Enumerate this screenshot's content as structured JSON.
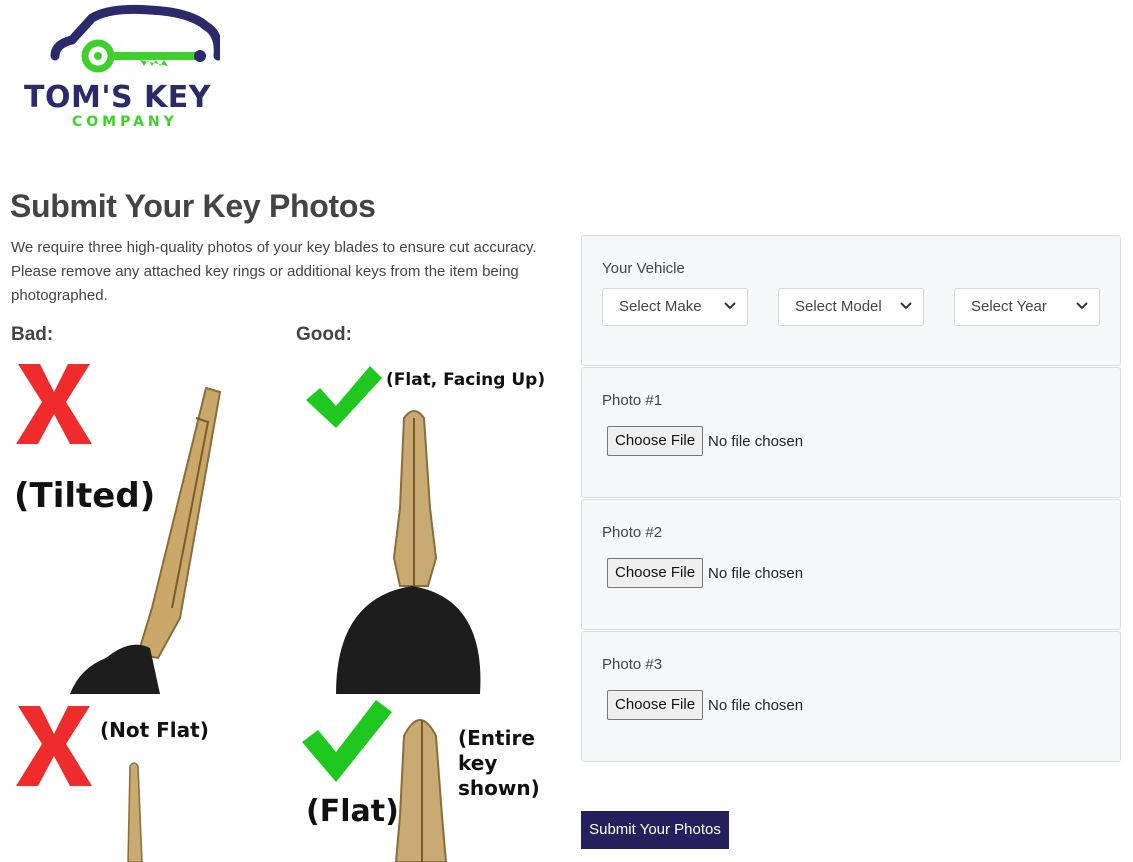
{
  "brand": {
    "name": "TOM'S KEY",
    "tagline": "COMPANY",
    "colors": {
      "navy": "#2b2a6b",
      "green": "#3ed12e"
    }
  },
  "page": {
    "title": "Submit Your Key Photos",
    "intro": "We require three high-quality photos of your key blades to ensure cut accuracy. Please remove any attached key rings or additional keys from the item being photographed."
  },
  "examples": {
    "bad_label": "Bad:",
    "good_label": "Good:",
    "bad_tilted_caption": "(Tilted)",
    "good_flat_facing_caption": "(Flat, Facing Up)",
    "bad_not_flat_caption": "(Not Flat)",
    "good_flat_caption": "(Flat)",
    "good_entire_caption_line1": "(Entire",
    "good_entire_caption_line2": "key",
    "good_entire_caption_line3": "shown)"
  },
  "form": {
    "vehicle": {
      "label": "Your Vehicle",
      "make": "Select Make",
      "model": "Select Model",
      "year": "Select Year"
    },
    "photos": [
      {
        "label": "Photo #1",
        "button": "Choose File",
        "status": "No file chosen"
      },
      {
        "label": "Photo #2",
        "button": "Choose File",
        "status": "No file chosen"
      },
      {
        "label": "Photo #3",
        "button": "Choose File",
        "status": "No file chosen"
      }
    ],
    "submit": "Submit Your Photos",
    "colors": {
      "submit_bg": "#24205e",
      "panel_bg": "#f6f7f9"
    }
  }
}
